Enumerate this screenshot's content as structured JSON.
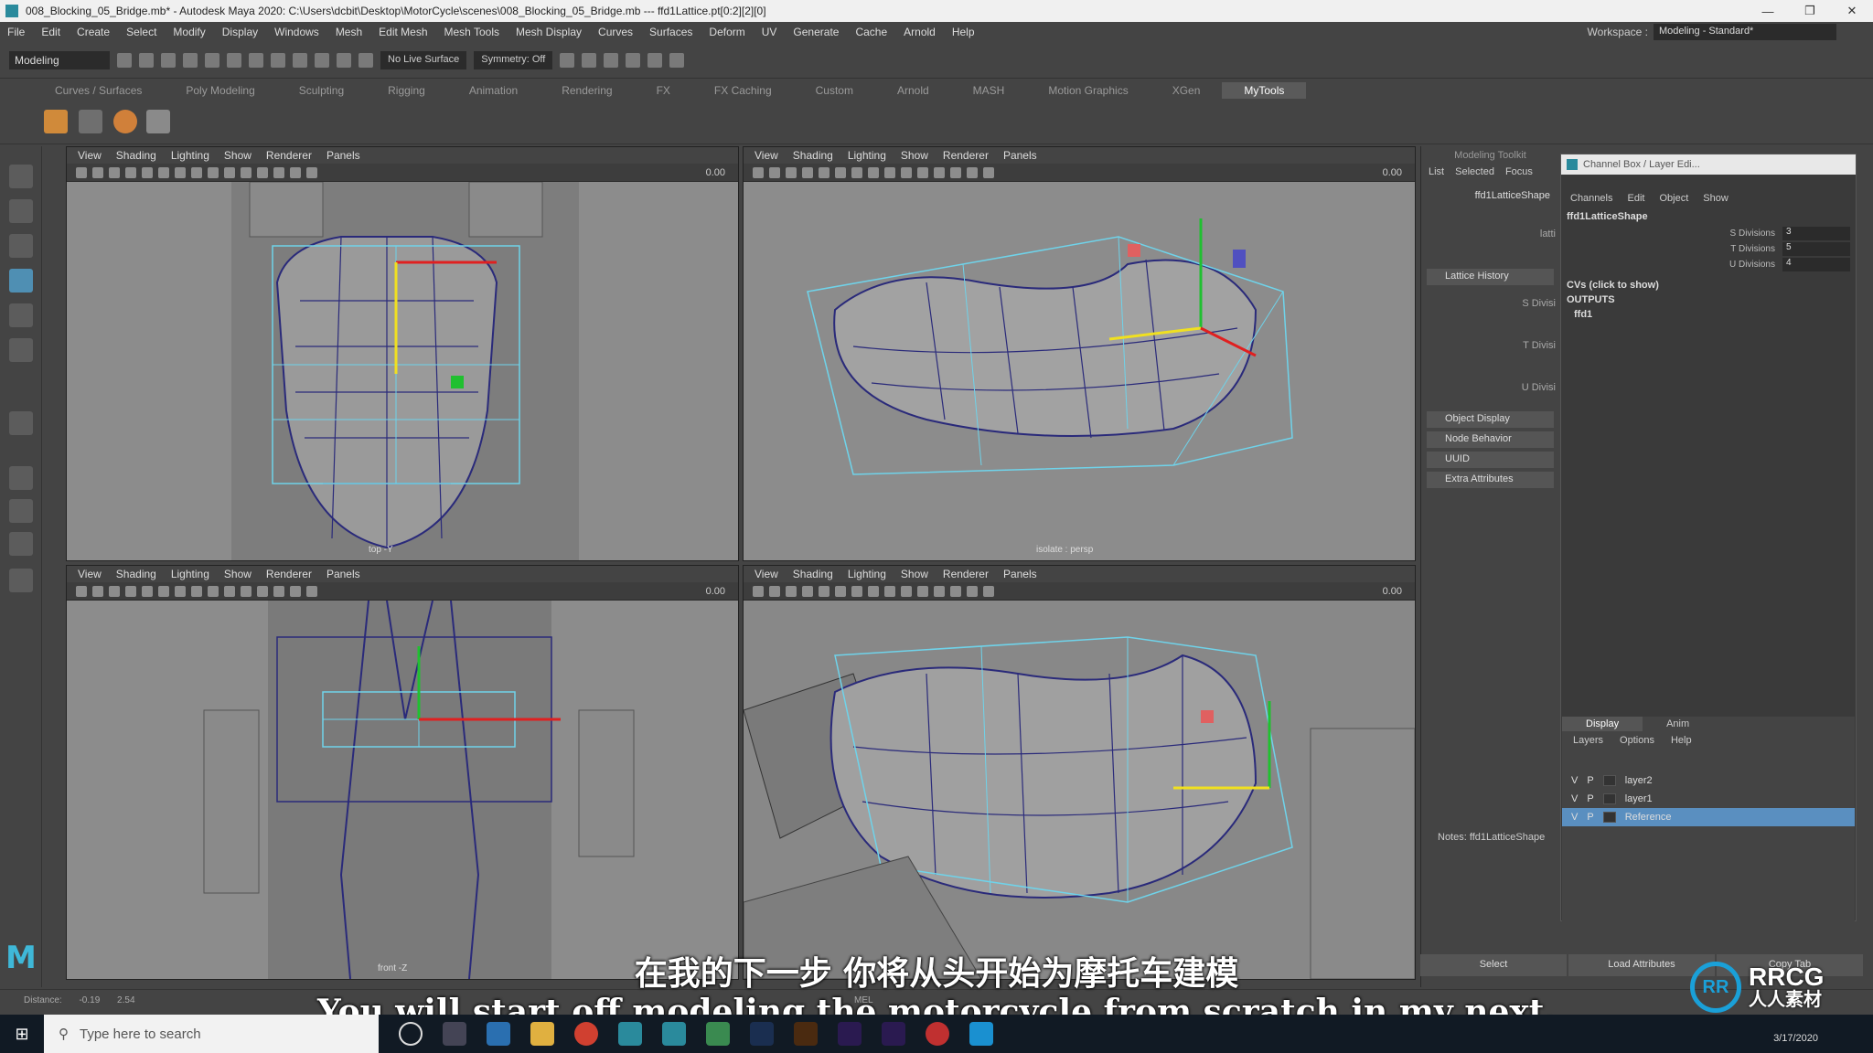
{
  "window": {
    "title": "008_Blocking_05_Bridge.mb* - Autodesk Maya 2020: C:\\Users\\dcbit\\Desktop\\MotorCycle\\scenes\\008_Blocking_05_Bridge.mb   ---   ffd1Lattice.pt[0:2][2][0]",
    "minimize": "—",
    "restore": "❐",
    "close": "✕"
  },
  "menu": [
    "File",
    "Edit",
    "Create",
    "Select",
    "Modify",
    "Display",
    "Windows",
    "Mesh",
    "Edit Mesh",
    "Mesh Tools",
    "Mesh Display",
    "Curves",
    "Surfaces",
    "Deform",
    "UV",
    "Generate",
    "Cache",
    "Arnold",
    "Help"
  ],
  "workspace": {
    "label": "Workspace :",
    "value": "Modeling - Standard*"
  },
  "statusline": {
    "mode": "Modeling",
    "live_surface": "No Live Surface",
    "symmetry": "Symmetry: Off"
  },
  "shelf_tabs": [
    "Curves / Surfaces",
    "Poly Modeling",
    "Sculpting",
    "Rigging",
    "Animation",
    "Rendering",
    "FX",
    "FX Caching",
    "Custom",
    "Arnold",
    "MASH",
    "Motion Graphics",
    "XGen",
    "MyTools"
  ],
  "shelf_active": "MyTools",
  "viewport_menu": [
    "View",
    "Shading",
    "Lighting",
    "Show",
    "Renderer",
    "Panels"
  ],
  "viewports": {
    "top": {
      "label": "top -Y",
      "value": "0.00"
    },
    "persp": {
      "label": "isolate : persp",
      "value": "0.00"
    },
    "front": {
      "label": "front -Z",
      "value": "0.00"
    },
    "cam": {
      "label": "",
      "value": "0.00"
    }
  },
  "toolkit": {
    "title": "Modeling Toolkit",
    "tabs": [
      "List",
      "Selected",
      "Focus"
    ],
    "node": "ffd1LatticeShape",
    "node_short": "latti",
    "sections": [
      "Lattice History",
      "Object Display",
      "Node Behavior",
      "UUID",
      "Extra Attributes"
    ],
    "labels": [
      "S Divisi",
      "T Divisi",
      "U Divisi"
    ],
    "notes": "Notes: ffd1LatticeShape"
  },
  "channel_box": {
    "title": "Channel Box / Layer Edi...",
    "menu": [
      "Channels",
      "Edit",
      "Object",
      "Show"
    ],
    "node": "ffd1LatticeShape",
    "attrs": [
      {
        "name": "S Divisions",
        "value": "3"
      },
      {
        "name": "T Divisions",
        "value": "5"
      },
      {
        "name": "U Divisions",
        "value": "4"
      }
    ],
    "cvs": "CVs (click to show)",
    "outputs": "OUTPUTS",
    "output_node": "ffd1"
  },
  "layers": {
    "tabs": [
      "Display",
      "Anim"
    ],
    "menu": [
      "Layers",
      "Options",
      "Help"
    ],
    "rows": [
      {
        "v": "V",
        "p": "P",
        "name": "layer2"
      },
      {
        "v": "V",
        "p": "P",
        "name": "layer1"
      },
      {
        "v": "V",
        "p": "P",
        "name": "Reference"
      }
    ]
  },
  "bottom_buttons": [
    "Select",
    "Load Attributes",
    "Copy Tab"
  ],
  "statusbar": {
    "distance_label": "Distance:",
    "value_a": "-0.19",
    "value_b": "2.54",
    "mel": "MEL"
  },
  "subtitles": {
    "cn": "在我的下一步 你将从头开始为摩托车建模",
    "en": "You will start off modeling the motorcycle from scratch in my next."
  },
  "taskbar": {
    "search_placeholder": "Type here to search",
    "date": "3/17/2020"
  },
  "watermark": {
    "logo": "RR",
    "line1": "RRCG",
    "line2": "人人素材"
  },
  "colors": {
    "lattice": "#6fd3ea",
    "mesh": "#2a2a7a",
    "manip_x": "#e02020",
    "manip_y": "#f0e020",
    "manip_z": "#20c030",
    "selection": "#5a8fc0"
  }
}
